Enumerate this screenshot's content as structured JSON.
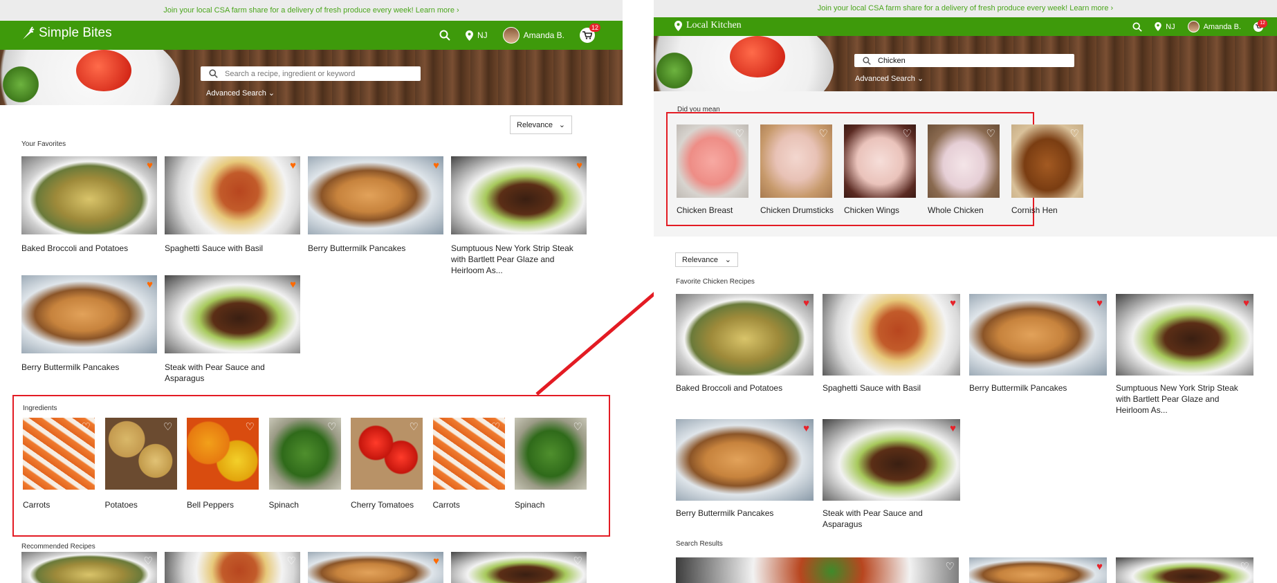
{
  "left": {
    "promo": {
      "text": "Join your local CSA farm share for a delivery of fresh produce every week!",
      "link": "Learn more ›"
    },
    "brand": {
      "name": "Simple Bites",
      "logo_icon": "carrot-icon"
    },
    "nav": {
      "location": "NJ",
      "user": "Amanda B.",
      "cart_count": "12"
    },
    "search": {
      "placeholder": "Search a recipe, ingredient or keyword",
      "advanced": "Advanced Search"
    },
    "sort": {
      "selected": "Relevance"
    },
    "favorites": {
      "title": "Your Favorites",
      "items": [
        {
          "label": "Baked Broccoli and Potatoes",
          "img": "food-casserole"
        },
        {
          "label": "Spaghetti Sauce with Basil",
          "img": "food-spaghetti"
        },
        {
          "label": "Berry Buttermilk Pancakes",
          "img": "food-pancakes"
        },
        {
          "label": "Sumptuous New York Strip Steak with Bartlett Pear Glaze and Heirloom As...",
          "img": "food-steak"
        },
        {
          "label": "Berry Buttermilk Pancakes",
          "img": "food-pancakes"
        },
        {
          "label": "Steak with Pear Sauce and Asparagus",
          "img": "food-steak"
        }
      ]
    },
    "ingredients": {
      "title": "Ingredients",
      "items": [
        {
          "label": "Carrots",
          "img": "veg-carrots"
        },
        {
          "label": "Potatoes",
          "img": "veg-potatoes"
        },
        {
          "label": "Bell Peppers",
          "img": "veg-peppers"
        },
        {
          "label": "Spinach",
          "img": "veg-spinach"
        },
        {
          "label": "Cherry Tomatoes",
          "img": "veg-tomatoes"
        },
        {
          "label": "Carrots",
          "img": "veg-carrots"
        },
        {
          "label": "Spinach",
          "img": "veg-spinach"
        }
      ]
    },
    "recommended": {
      "title": "Recommended Recipes"
    }
  },
  "right": {
    "promo": {
      "text": "Join your local CSA farm share for a delivery of fresh produce every week!",
      "link": "Learn more ›"
    },
    "brand": {
      "name": "Local Kitchen",
      "logo_icon": "location-pin-icon"
    },
    "nav": {
      "location": "NJ",
      "user": "Amanda B.",
      "cart_count": "12"
    },
    "search": {
      "value": "Chicken",
      "advanced": "Advanced Search"
    },
    "did_you_mean": {
      "title": "Did you mean",
      "items": [
        {
          "label": "Chicken Breast",
          "img": "ch-breast"
        },
        {
          "label": "Chicken Drumsticks",
          "img": "ch-drum"
        },
        {
          "label": "Chicken Wings",
          "img": "ch-wings"
        },
        {
          "label": "Whole Chicken",
          "img": "ch-whole"
        },
        {
          "label": "Cornish Hen",
          "img": "ch-hen"
        }
      ]
    },
    "sort": {
      "selected": "Relevance"
    },
    "favorites": {
      "title": "Favorite Chicken Recipes",
      "items": [
        {
          "label": "Baked Broccoli and Potatoes",
          "img": "food-casserole"
        },
        {
          "label": "Spaghetti Sauce with Basil",
          "img": "food-spaghetti"
        },
        {
          "label": "Berry Buttermilk Pancakes",
          "img": "food-pancakes"
        },
        {
          "label": "Sumptuous New York Strip Steak with Bartlett Pear Glaze and Heirloom As...",
          "img": "food-steak"
        },
        {
          "label": "Berry Buttermilk Pancakes",
          "img": "food-pancakes"
        },
        {
          "label": "Steak with Pear Sauce and Asparagus",
          "img": "food-steak"
        }
      ]
    },
    "search_results": {
      "title": "Search Results"
    }
  },
  "colors": {
    "brand_green": "#3e9a0b",
    "promo_green": "#4aa51b",
    "highlight_red": "#e31b23",
    "heart_orange": "#ff6a00",
    "heart_red": "#e6232b"
  }
}
